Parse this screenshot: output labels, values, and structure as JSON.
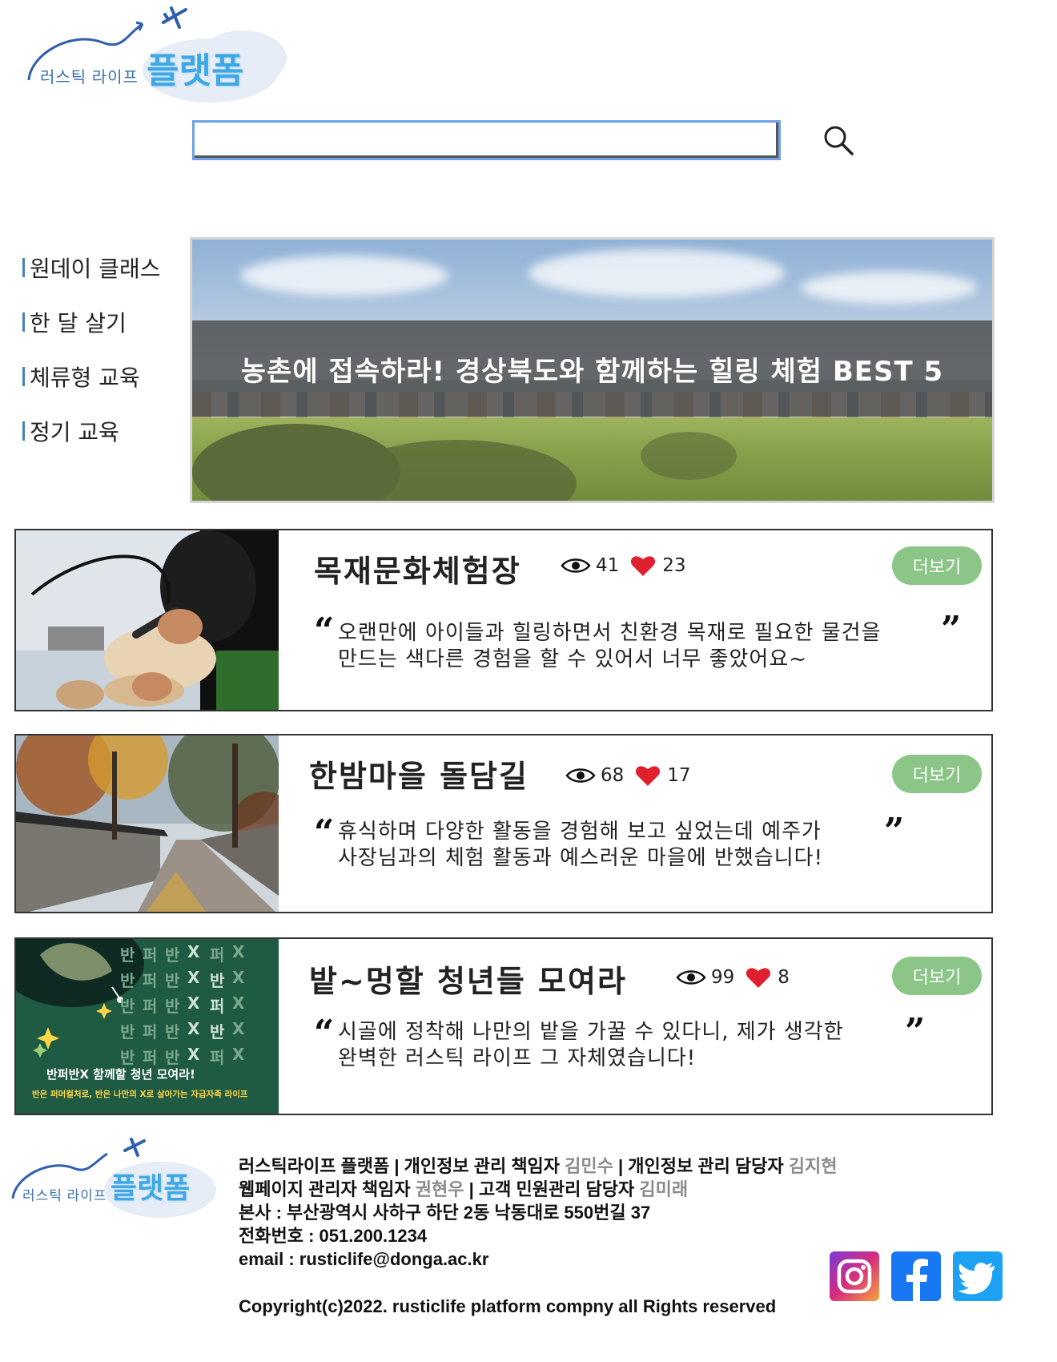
{
  "logo": {
    "sub_text": "러스틱 라이프",
    "main_text": "플랫폼"
  },
  "search": {
    "value": "",
    "placeholder": ""
  },
  "sidebar": {
    "items": [
      {
        "label": "원데이 클래스"
      },
      {
        "label": "한 달 살기"
      },
      {
        "label": "체류형 교육"
      },
      {
        "label": "정기 교육"
      }
    ]
  },
  "hero": {
    "title": "농촌에 접속하라! 경상북도와 함께하는 힐링 체험 BEST 5"
  },
  "cards": [
    {
      "title": "목재문화체험장",
      "views": "41",
      "likes": "23",
      "more_label": "더보기",
      "quote_lines": [
        "오랜만에 아이들과 힐링하면서 친환경 목재로 필요한 물건을",
        "만드는 색다른 경험을 할 수 있어서 너무 좋았어요~"
      ]
    },
    {
      "title": "한밤마을 돌담길",
      "views": "68",
      "likes": "17",
      "more_label": "더보기",
      "quote_lines": [
        "휴식하며 다양한 활동을 경험해 보고 싶었는데 예주가",
        "사장님과의 체험 활동과 예스러운 마을에 반했습니다!"
      ]
    },
    {
      "title": "밭~멍할 청년들 모여라",
      "views": "99",
      "likes": "8",
      "more_label": "더보기",
      "quote_lines": [
        "시골에 정착해 나만의 밭을 가꿀 수 있다니, 제가 생각한",
        "완벽한 러스틱 라이프 그 자체였습니다!"
      ],
      "poster": {
        "headline": "반퍼반X 함께할 청년 모여라!",
        "subline": "반은 퍼머컬처로, 반은 나만의 X로 살아가는 자급자족 라이프",
        "grid_chars": [
          "반",
          "퍼",
          "반",
          "X"
        ]
      }
    }
  ],
  "quote_marks": {
    "open": "“",
    "close": "”"
  },
  "footer": {
    "line1": {
      "a": "러스틱라이프 플랫폼 | 개인정보 관리 책임자 ",
      "n1": "김민수",
      "b": " | 개인정보 관리 담당자 ",
      "n2": "김지현"
    },
    "line2": {
      "a": "웹페이지 관리자 책임자 ",
      "n1": "권현우",
      "b": " | 고객 민원관리 담당자 ",
      "n2": "김미래"
    },
    "address": "본사 : 부산광역시 사하구 하단 2동 낙동대로 550번길 37",
    "phone": "전화번호 : 051.200.1234",
    "email": "email : rusticlife@donga.ac.kr",
    "copyright": "Copyright(c)2022. rusticlife platform compny all Rights reserved"
  },
  "colors": {
    "accent_blue": "#6ea1e8",
    "more_green": "#8cc588",
    "heart_red": "#e0202e",
    "logo_blue": "#3ea7e6"
  },
  "icons": [
    "search-icon",
    "eye-icon",
    "heart-icon",
    "instagram-icon",
    "facebook-icon",
    "twitter-icon",
    "airplane-icon"
  ]
}
